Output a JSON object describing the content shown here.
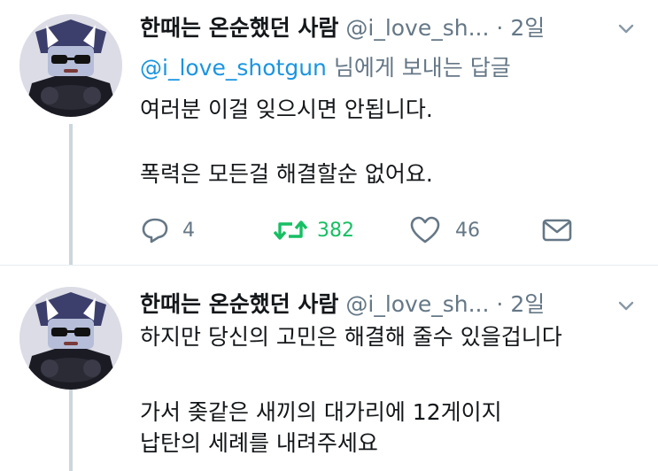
{
  "tweets": [
    {
      "display_name": "한때는 온순했던 사람",
      "handle": "@i_love_sh...",
      "separator": "·",
      "time": "2일",
      "reply_to": {
        "mention": "@i_love_shotgun",
        "suffix": "님에게 보내는 답글"
      },
      "lines": [
        "여러분 이걸 잊으시면 안됩니다.",
        "폭력은 모든걸 해결할순 없어요."
      ],
      "actions": {
        "reply_count": "4",
        "retweet_count": "382",
        "like_count": "46"
      },
      "icons": [
        "reply-icon",
        "retweet-icon",
        "like-icon",
        "direct-message-icon",
        "chevron-down-icon"
      ]
    },
    {
      "display_name": "한때는 온순했던 사람",
      "handle": "@i_love_sh...",
      "separator": "·",
      "time": "2일",
      "lines": [
        "하지만 당신의 고민은 해결해 줄수 있을겁니다",
        "가서 좆같은 새끼의 대가리에 12게이지",
        "납탄의 세례를 내려주세요"
      ]
    }
  ],
  "colors": {
    "text": "#14171a",
    "secondary": "#657786",
    "link": "#1b95e0",
    "retweet": "#17bf63",
    "thread_line": "#ccd6dd"
  }
}
